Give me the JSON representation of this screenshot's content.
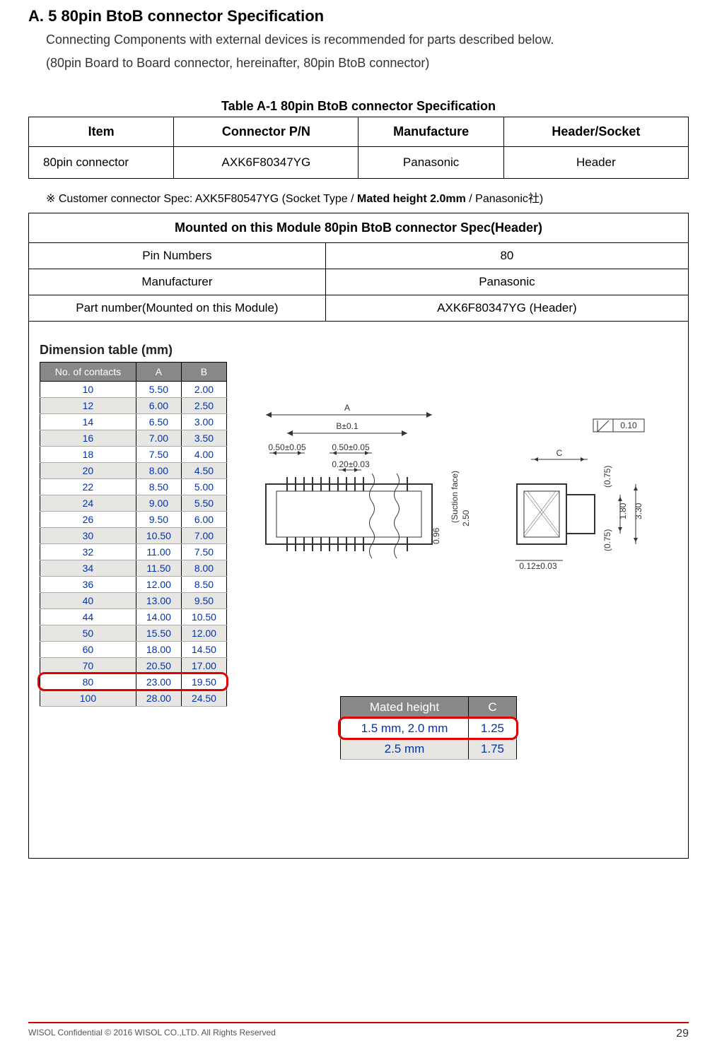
{
  "heading": "A. 5  80pin BtoB connector Specification",
  "intro1": "Connecting Components with external devices is recommended for parts described below.",
  "intro2": "(80pin Board to Board connector, hereinafter, 80pin BtoB connector)",
  "table1_caption": "Table A-1  80pin BtoB connector Specification",
  "table1": {
    "headers": [
      "Item",
      "Connector P/N",
      "Manufacture",
      "Header/Socket"
    ],
    "row": [
      "80pin connector",
      "AXK6F80347YG",
      "Panasonic",
      "Header"
    ]
  },
  "note_prefix": "※ Customer connector Spec: AXK5F80547YG (Socket Type / ",
  "note_bold": "Mated height 2.0mm",
  "note_suffix": " / Panasonic社)",
  "module_header": "Mounted on this Module 80pin BtoB connector Spec(Header)",
  "module_rows": [
    [
      "Pin Numbers",
      "80"
    ],
    [
      "Manufacturer",
      "Panasonic"
    ],
    [
      "Part number(Mounted on this Module)",
      "AXK6F80347YG (Header)"
    ]
  ],
  "dim_title": "Dimension table (mm)",
  "dim_headers": [
    "No. of contacts",
    "A",
    "B"
  ],
  "dim_rows": [
    [
      "10",
      "5.50",
      "2.00"
    ],
    [
      "12",
      "6.00",
      "2.50"
    ],
    [
      "14",
      "6.50",
      "3.00"
    ],
    [
      "16",
      "7.00",
      "3.50"
    ],
    [
      "18",
      "7.50",
      "4.00"
    ],
    [
      "20",
      "8.00",
      "4.50"
    ],
    [
      "22",
      "8.50",
      "5.00"
    ],
    [
      "24",
      "9.00",
      "5.50"
    ],
    [
      "26",
      "9.50",
      "6.00"
    ],
    [
      "30",
      "10.50",
      "7.00"
    ],
    [
      "32",
      "11.00",
      "7.50"
    ],
    [
      "34",
      "11.50",
      "8.00"
    ],
    [
      "36",
      "12.00",
      "8.50"
    ],
    [
      "40",
      "13.00",
      "9.50"
    ],
    [
      "44",
      "14.00",
      "10.50"
    ],
    [
      "50",
      "15.50",
      "12.00"
    ],
    [
      "60",
      "18.00",
      "14.50"
    ],
    [
      "70",
      "20.50",
      "17.00"
    ],
    [
      "80",
      "23.00",
      "19.50"
    ],
    [
      "100",
      "28.00",
      "24.50"
    ]
  ],
  "drawing_labels": {
    "A": "A",
    "B": "B±0.1",
    "d1": "0.50±0.05",
    "d2": "0.50±0.05",
    "d3": "0.20±0.03",
    "v1": "0.96",
    "suction": "(Suction face)",
    "h_suction": "2.50",
    "tol": "0.10",
    "C": "C",
    "p1": "(0.75)",
    "p2": "(0.75)",
    "w1": "1.80",
    "w2": "3.30",
    "b1": "0.12±0.03"
  },
  "mated_headers": [
    "Mated height",
    "C"
  ],
  "mated_rows": [
    [
      "1.5 mm, 2.0 mm",
      "1.25"
    ],
    [
      "2.5 mm",
      "1.75"
    ]
  ],
  "footer_left": "WISOL Confidential © 2016 WISOL CO.,LTD.  All Rights Reserved",
  "footer_page": "29"
}
